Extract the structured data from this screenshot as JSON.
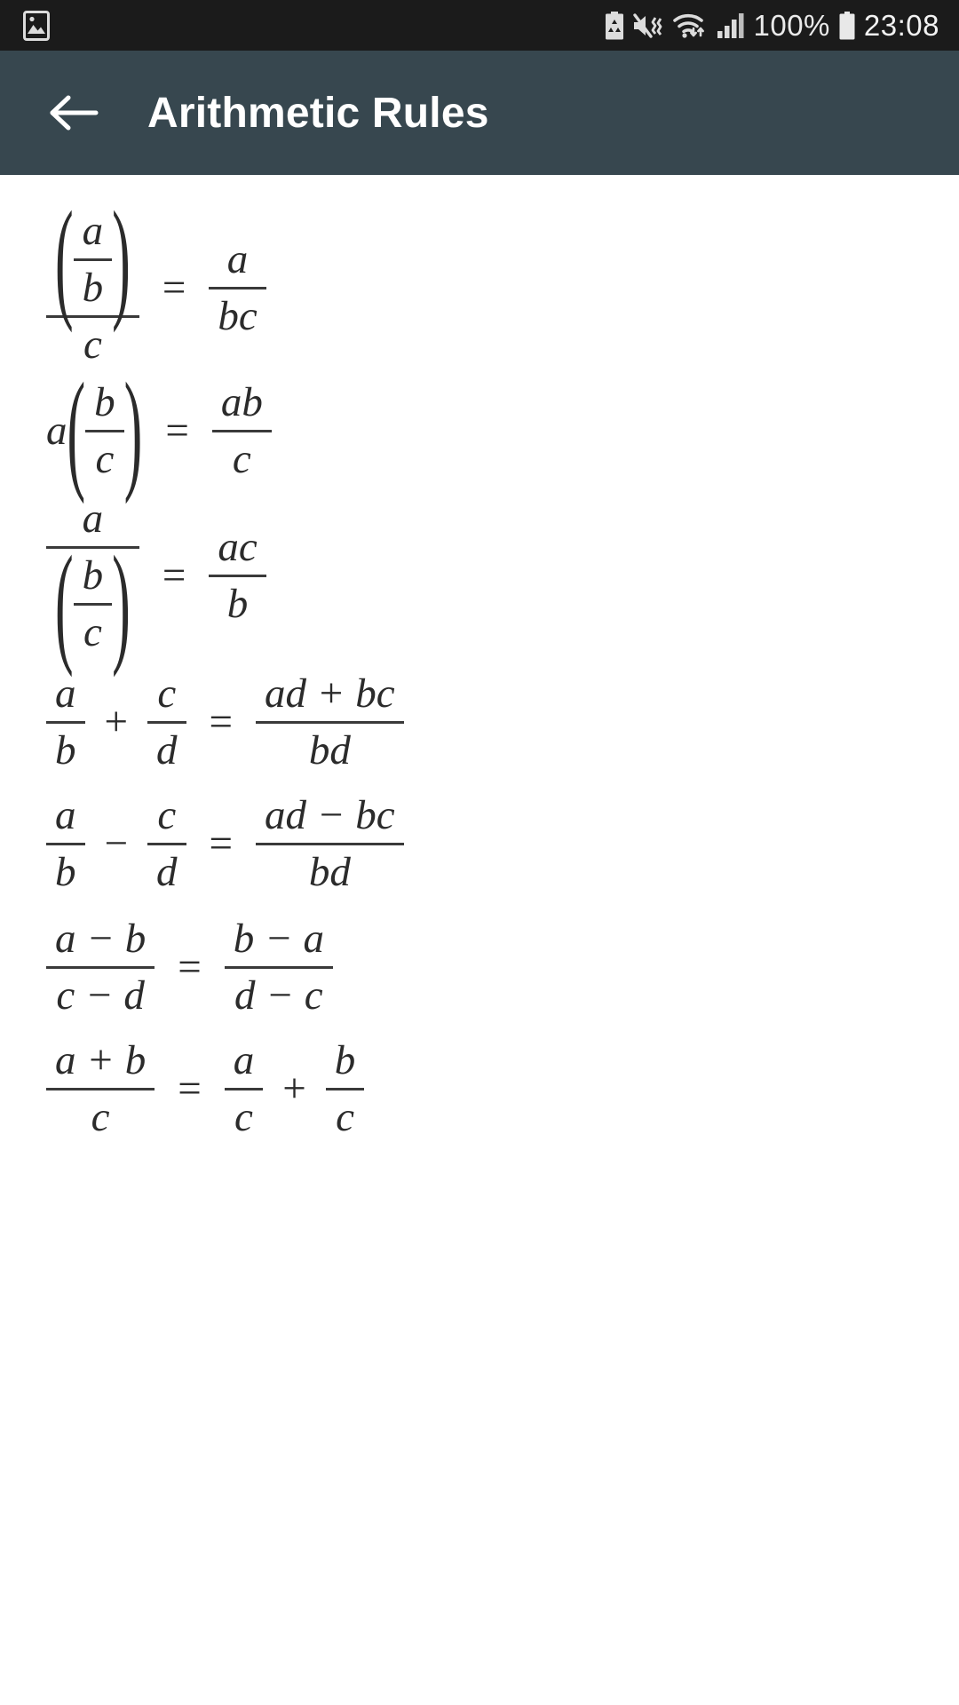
{
  "status_bar": {
    "left_icons": [
      {
        "name": "gallery-image-icon",
        "label": "image"
      }
    ],
    "right_icons": [
      {
        "name": "battery-saver-icon",
        "label": "battery saver"
      },
      {
        "name": "volume-mute-vibrate-icon",
        "label": "mute"
      },
      {
        "name": "wifi-icon",
        "label": "wifi"
      },
      {
        "name": "cellular-signal-icon",
        "label": "signal"
      }
    ],
    "battery_percent": "100%",
    "battery_icon": "battery-full-icon",
    "time": "23:08",
    "background_color": "#1b1b1b",
    "foreground_color": "#eaeaea"
  },
  "app_bar": {
    "back_icon": "arrow-left-icon",
    "title": "Arithmetic Rules",
    "background_color": "#37474f",
    "title_color": "#ffffff"
  },
  "content": {
    "background_color": "#ffffff",
    "text_color": "#2b2b2b",
    "formulas": [
      {
        "id": "divide-fraction-by-scalar",
        "latex": "\\frac{\\left(\\frac{a}{b}\\right)}{c} = \\frac{a}{bc}",
        "parts": {
          "lhs_num_num": "a",
          "lhs_num_den": "b",
          "lhs_den": "c",
          "eq": "=",
          "rhs_num": "a",
          "rhs_den": "bc"
        }
      },
      {
        "id": "scalar-times-fraction",
        "latex": "a\\left(\\frac{b}{c}\\right) = \\frac{ab}{c}",
        "parts": {
          "lhs_lead": "a",
          "lhs_num": "b",
          "lhs_den": "c",
          "eq": "=",
          "rhs_num": "ab",
          "rhs_den": "c"
        }
      },
      {
        "id": "scalar-divided-by-fraction",
        "latex": "\\frac{a}{\\left(\\frac{b}{c}\\right)} = \\frac{ac}{b}",
        "parts": {
          "lhs_num": "a",
          "lhs_den_num": "b",
          "lhs_den_den": "c",
          "eq": "=",
          "rhs_num": "ac",
          "rhs_den": "b"
        }
      },
      {
        "id": "add-fractions",
        "latex": "\\frac{a}{b} + \\frac{c}{d} = \\frac{ad + bc}{bd}",
        "parts": {
          "l_num": "a",
          "l_den": "b",
          "op": "+",
          "m_num": "c",
          "m_den": "d",
          "eq": "=",
          "r_num": "ad + bc",
          "r_den": "bd"
        }
      },
      {
        "id": "subtract-fractions",
        "latex": "\\frac{a}{b} - \\frac{c}{d} = \\frac{ad - bc}{bd}",
        "parts": {
          "l_num": "a",
          "l_den": "b",
          "op": "−",
          "m_num": "c",
          "m_den": "d",
          "eq": "=",
          "r_num": "ad − bc",
          "r_den": "bd"
        }
      },
      {
        "id": "negate-numerator-and-denominator",
        "latex": "\\frac{a-b}{c-d} = \\frac{b-a}{d-c}",
        "parts": {
          "l_num": "a − b",
          "l_den": "c − d",
          "eq": "=",
          "r_num": "b − a",
          "r_den": "d − c"
        }
      },
      {
        "id": "split-sum-numerator",
        "latex": "\\frac{a+b}{c} = \\frac{a}{c} + \\frac{b}{c}",
        "parts": {
          "l_num": "a + b",
          "l_den": "c",
          "eq": "=",
          "m_num": "a",
          "m_den": "c",
          "op": "+",
          "r_num": "b",
          "r_den": "c"
        }
      }
    ]
  }
}
